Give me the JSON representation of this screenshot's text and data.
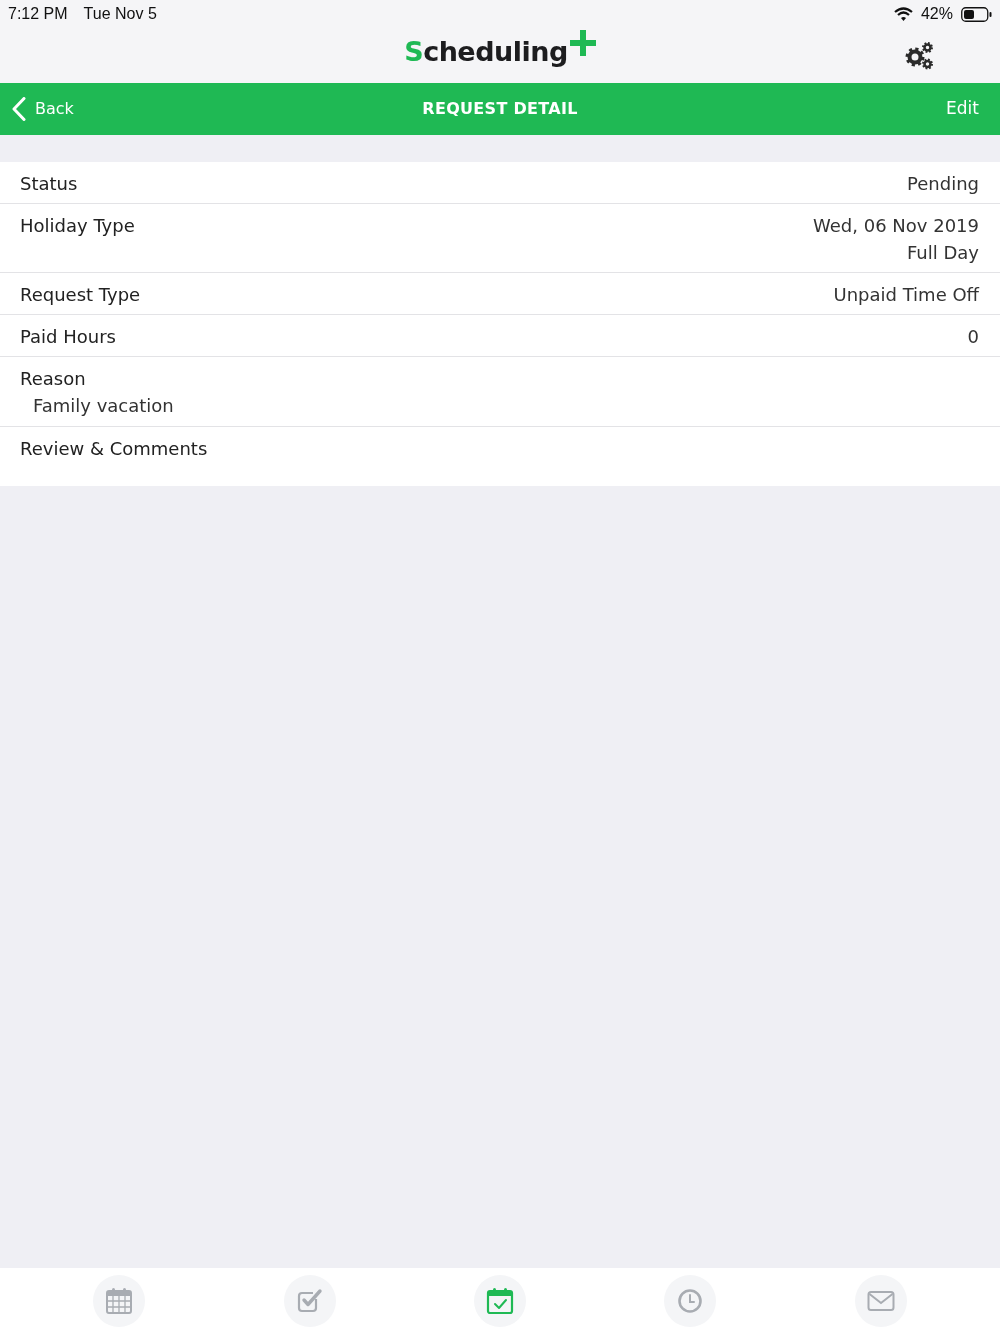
{
  "status_bar": {
    "time": "7:12 PM",
    "date": "Tue Nov 5",
    "battery": "42%"
  },
  "header": {
    "logo": "Scheduling"
  },
  "nav_bar": {
    "back": "Back",
    "title": "REQUEST DETAIL",
    "action": "Edit"
  },
  "details": [
    {
      "kind": "inline",
      "label": "Status",
      "values": [
        "Pending"
      ]
    },
    {
      "kind": "inline",
      "label": "Holiday Type",
      "values": [
        "Wed, 06 Nov 2019",
        "Full Day"
      ]
    },
    {
      "kind": "inline",
      "label": "Request Type",
      "values": [
        "Unpaid Time Off"
      ]
    },
    {
      "kind": "inline",
      "label": "Paid Hours",
      "values": [
        "0"
      ]
    },
    {
      "kind": "stacked",
      "label": "Reason",
      "values": [
        "Family vacation"
      ]
    },
    {
      "kind": "stacked",
      "label": "Review & Comments"
    }
  ],
  "tab_bar": [
    {
      "selected": false
    },
    {
      "selected": false
    },
    {
      "selected": true
    },
    {
      "selected": false
    },
    {
      "selected": false
    }
  ]
}
